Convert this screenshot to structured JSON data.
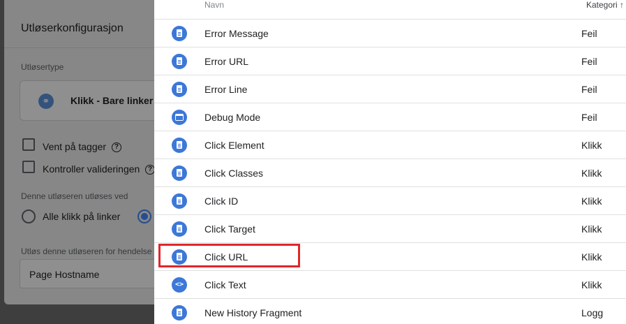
{
  "trigger_config": {
    "title": "Utløserkonfigurasjon",
    "trigger_type_label": "Utløsertype",
    "trigger_type_value": "Klikk - Bare linker",
    "wait_for_tags": "Vent på tagger",
    "check_validation": "Kontroller valideringen",
    "fires_on_label": "Denne utløseren utløses ved",
    "all_link_clicks": "Alle klikk på linker",
    "fire_when_label": "Utløs denne utløseren for hendelse",
    "condition_variable": "Page Hostname",
    "help_glyph": "?",
    "link_icon": "link-icon"
  },
  "variable_picker": {
    "columns": {
      "name": "Navn",
      "category": "Kategori"
    },
    "rows": [
      {
        "name": "Error Message",
        "category": "Feil",
        "icon": "document-icon"
      },
      {
        "name": "Error URL",
        "category": "Feil",
        "icon": "document-icon"
      },
      {
        "name": "Error Line",
        "category": "Feil",
        "icon": "document-icon"
      },
      {
        "name": "Debug Mode",
        "category": "Feil",
        "icon": "window-icon"
      },
      {
        "name": "Click Element",
        "category": "Klikk",
        "icon": "document-icon"
      },
      {
        "name": "Click Classes",
        "category": "Klikk",
        "icon": "document-icon"
      },
      {
        "name": "Click ID",
        "category": "Klikk",
        "icon": "document-icon"
      },
      {
        "name": "Click Target",
        "category": "Klikk",
        "icon": "document-icon"
      },
      {
        "name": "Click URL",
        "category": "Klikk",
        "icon": "document-icon"
      },
      {
        "name": "Click Text",
        "category": "Klikk",
        "icon": "code-icon"
      },
      {
        "name": "New History Fragment",
        "category": "Logg",
        "icon": "document-icon"
      }
    ],
    "highlighted_row": "Click URL",
    "highlight_color": "#e0262a"
  },
  "colors": {
    "accent": "#3c78d8",
    "overlay_dim": "#6b6b6b"
  }
}
